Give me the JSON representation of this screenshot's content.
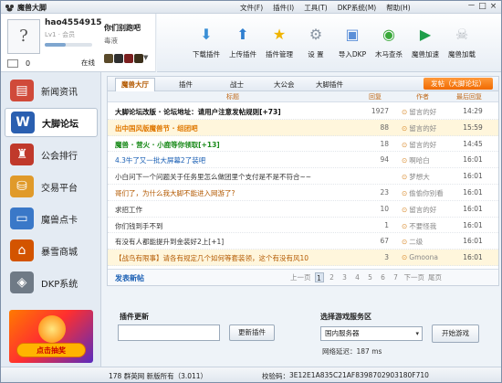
{
  "window": {
    "title": "魔兽大脚",
    "menu": [
      "文件(F)",
      "插件(I)",
      "工具(T)",
      "DKP系统(M)",
      "帮助(H)"
    ],
    "controls": [
      "－",
      "□",
      "×"
    ]
  },
  "user": {
    "name": "hao4554915",
    "level_text": "Lv1 · 会员",
    "level_progress": 0.45,
    "online_label": "在线",
    "mail_count": "0",
    "team_name": "你们别跑吧",
    "team_sub": "毒液"
  },
  "toolbar": [
    {
      "label": "下载插件",
      "icon": "download-icon",
      "color": "#3a8fd6"
    },
    {
      "label": "上传插件",
      "icon": "upload-icon",
      "color": "#2f7fd0"
    },
    {
      "label": "插件管理",
      "icon": "plugin-manage-icon",
      "color": "#f0b400"
    },
    {
      "label": "设 置",
      "icon": "gear-icon",
      "color": "#8a96a3"
    },
    {
      "label": "导入DKP",
      "icon": "import-dkp-icon",
      "color": "#5b8fd8"
    },
    {
      "label": "木马查杀",
      "icon": "trojan-scan-icon",
      "color": "#3aa93a"
    },
    {
      "label": "魔兽加速",
      "icon": "accelerate-icon",
      "color": "#1e9e4a"
    },
    {
      "label": "魔兽加载",
      "icon": "skull-icon",
      "color": "#b7bcc2"
    }
  ],
  "nav": [
    {
      "label": "新闻资讯",
      "icon": "news-icon",
      "color": "#d04a3a"
    },
    {
      "label": "大脚论坛",
      "icon": "forum-icon",
      "color": "#2a5fb0",
      "active": true
    },
    {
      "label": "公会排行",
      "icon": "guild-rank-icon",
      "color": "#c0392b"
    },
    {
      "label": "交易平台",
      "icon": "trade-icon",
      "color": "#e09a2a"
    },
    {
      "label": "魔兽点卡",
      "icon": "card-icon",
      "color": "#3a78c8"
    },
    {
      "label": "暴雪商城",
      "icon": "shop-icon",
      "color": "#d35400"
    },
    {
      "label": "DKP系统",
      "icon": "dkp-icon",
      "color": "#6f7a86"
    }
  ],
  "promo": {
    "button": "点击抽奖"
  },
  "forum": {
    "tabs": [
      "魔兽大厅",
      "插件",
      "战士",
      "大公会",
      "大脚插件"
    ],
    "post_button": "发帖（大脚论坛）",
    "columns": {
      "title": "标题",
      "replies": "回复",
      "author": "作者",
      "last": "最后回复"
    },
    "rows": [
      {
        "title": "大脚论坛改版 · 论坛地址：请用户注意发帖规则[+73]",
        "replies": "1927",
        "author": "留言的好",
        "time": "14:29",
        "color": "#111",
        "bold": true
      },
      {
        "title": "出中国风版魔兽节 · 组团吧",
        "replies": "88",
        "author": "留言的好",
        "time": "15:59",
        "color": "#e07800",
        "bold": true,
        "shade": true
      },
      {
        "title": "魔兽 · 营火 · 小鹿等你领取[+13]",
        "replies": "18",
        "author": "留言的好",
        "time": "14:45",
        "color": "#1a8a1a",
        "bold": true
      },
      {
        "title": "4.3牛了又一批大屏幕2了装吧",
        "replies": "94",
        "author": "啊哈白",
        "time": "16:01",
        "color": "#1a5fb4"
      },
      {
        "title": "小白问下一个问题关于任务里怎么做团里个支付是不是不符合~~",
        "replies": "",
        "author": "梦想大",
        "time": "16:01",
        "color": "#333"
      },
      {
        "title": "哥们了，为什么我大脚不能进入网游了?",
        "replies": "23",
        "author": "偷偷你别看",
        "time": "16:01",
        "color": "#b35900"
      },
      {
        "title": "求招工作",
        "replies": "10",
        "author": "留言的好",
        "time": "16:01",
        "color": "#333"
      },
      {
        "title": "你们钱到手不到",
        "replies": "1",
        "author": "不要怪我",
        "time": "16:01",
        "color": "#333"
      },
      {
        "title": "有没有人都能提升到金装好2上[+1]",
        "replies": "67",
        "author": "二级",
        "time": "16:01",
        "color": "#333"
      },
      {
        "title": "【战鸟有限事】请各有规定几个如何等套装领，这个有没有风10",
        "replies": "3",
        "author": "Gmoona",
        "time": "16:01",
        "color": "#b35900",
        "shade": true
      },
      {
        "title": "",
        "replies": "",
        "author": "",
        "time": "",
        "color": "#333"
      }
    ],
    "new_post": "发表新帖",
    "pages": [
      "上一页",
      "1",
      "2",
      "3",
      "4",
      "5",
      "6",
      "7",
      "下一页",
      "尾页"
    ],
    "current_page": "1"
  },
  "plugin_update": {
    "title": "插件更新",
    "input_value": "",
    "button": "更新插件"
  },
  "server": {
    "title": "选择游戏服务区",
    "selected": "国内服务器",
    "start_button": "开始游戏",
    "latency": "网络延迟：187 ms"
  },
  "status": {
    "left": "178 群英网  新版所有（3.011）",
    "code_label": "校验码：",
    "code": "3E12E1A835C21AF8398702903180F710"
  }
}
